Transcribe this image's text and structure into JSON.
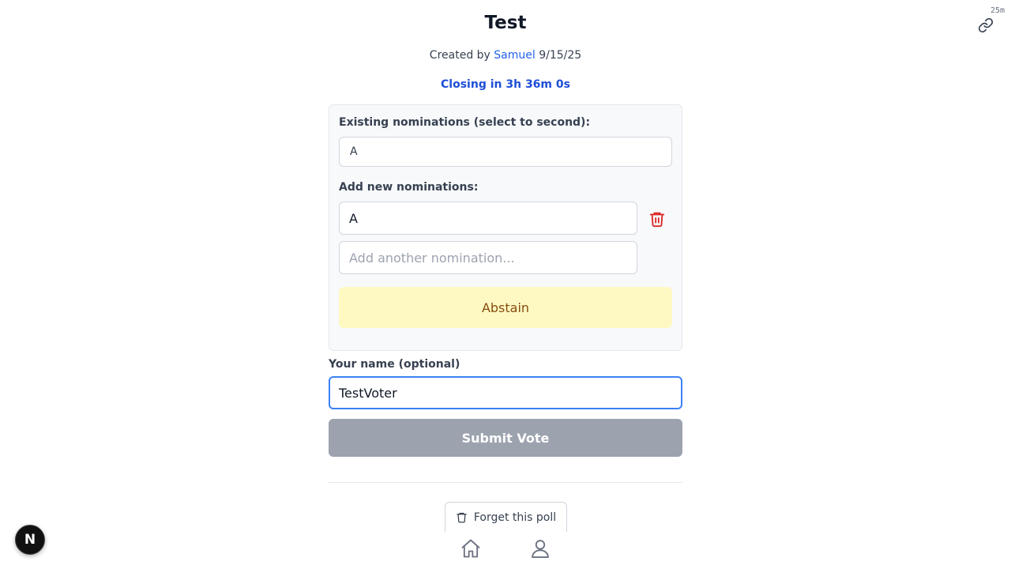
{
  "poll": {
    "title": "Test",
    "created_prefix": "Created by",
    "author": "Samuel",
    "date": "9/15/25",
    "countdown": "Closing in 3h 36m 0s",
    "age": "25m"
  },
  "nominations": {
    "existing_label": "Existing nominations (select to second):",
    "existing": [
      "A"
    ],
    "add_label": "Add new nominations:",
    "new_entries": [
      "A"
    ],
    "new_placeholder": "Add another nomination...",
    "abstain_label": "Abstain"
  },
  "voter": {
    "name_label": "Your name (optional)",
    "name_value": "TestVoter"
  },
  "actions": {
    "submit_label": "Submit Vote",
    "forget_label": "Forget this poll"
  },
  "badge": {
    "letter": "N"
  },
  "icons": {
    "share": "link-icon",
    "delete": "trash-icon",
    "home": "home-icon",
    "profile": "user-icon"
  },
  "colors": {
    "accent": "#2563eb",
    "countdown": "#1d4ed8",
    "danger": "#dc2626",
    "abstain_bg": "#fef9c3",
    "abstain_text": "#854d0e",
    "submit_disabled": "#9ca3af",
    "focus_ring": "#3b82f6"
  }
}
